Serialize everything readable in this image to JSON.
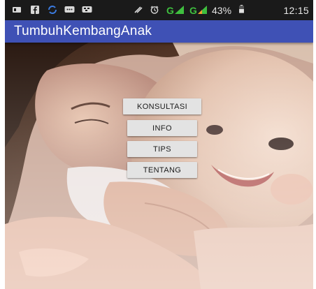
{
  "status_bar": {
    "icons": [
      "notification-icon",
      "facebook-icon",
      "sync-icon",
      "message-icon",
      "bbm-icon",
      "vibrate-icon",
      "alarm-icon",
      "signal-icon",
      "signal-icon"
    ],
    "network_1": "G",
    "network_2": "G",
    "battery_percent": "43%",
    "time": "12:15"
  },
  "app_bar": {
    "title": "TumbuhKembangAnak",
    "color": "#3f51b5"
  },
  "menu": {
    "buttons": [
      {
        "label": "KONSULTASI"
      },
      {
        "label": "INFO"
      },
      {
        "label": "TIPS"
      },
      {
        "label": "TENTANG"
      }
    ]
  },
  "background": {
    "description_icon": "mother-baby-photo"
  }
}
